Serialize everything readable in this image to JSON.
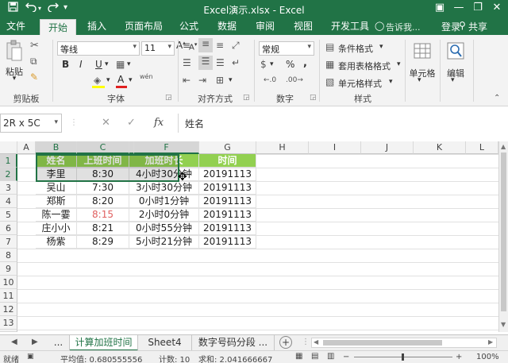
{
  "titlebar": {
    "title": "Excel演示.xlsx - Excel",
    "save_icon": "save-icon",
    "undo_icon": "undo-icon",
    "redo_icon": "redo-icon",
    "qa_more_icon": "customize-quick-access-icon",
    "ribbon_display": "▣",
    "minimize": "—",
    "restore": "❐",
    "close": "✕"
  },
  "tabs": {
    "items": [
      "文件",
      "开始",
      "插入",
      "页面布局",
      "公式",
      "数据",
      "审阅",
      "视图",
      "开发工具"
    ],
    "active": "开始",
    "tellme": "告诉我...",
    "login": "登录",
    "share": "共享"
  },
  "ribbon": {
    "clipboard": {
      "paste": "粘贴",
      "label": "剪贴板"
    },
    "font": {
      "name": "等线",
      "size": "11",
      "bold": "B",
      "italic": "I",
      "underline": "U",
      "grow": "A",
      "shrink": "A",
      "label": "字体",
      "wen": "wén"
    },
    "alignment": {
      "label": "对齐方式"
    },
    "number": {
      "format": "常规",
      "percent": "%",
      "comma": ",",
      "label": "数字"
    },
    "styles": {
      "conditional": "条件格式",
      "table": "套用表格格式",
      "cell": "单元格样式",
      "label": "样式"
    },
    "cells": {
      "label": "单元格"
    },
    "editing": {
      "label": "编辑"
    }
  },
  "formulabar": {
    "namebox": "2R x 5C",
    "cancel": "✕",
    "enter": "✓",
    "fx": "fx",
    "content": "姓名"
  },
  "grid": {
    "columns": [
      "A",
      "B",
      "C",
      "E",
      "F",
      "G",
      "H",
      "I",
      "J",
      "K",
      "L"
    ],
    "rows": [
      "1",
      "2",
      "3",
      "4",
      "5",
      "6",
      "7",
      "8",
      "9",
      "10",
      "11",
      "12",
      "13",
      "14"
    ],
    "header": {
      "name": "姓名",
      "start": "上班时间",
      "overtime": "加班时长",
      "time": "时间"
    },
    "data": [
      {
        "name": "李里",
        "start": "8:30",
        "overtime": "4小时30分钟",
        "time": "20191113"
      },
      {
        "name": "吴山",
        "start": "7:30",
        "overtime": "3小时30分钟",
        "time": "20191113"
      },
      {
        "name": "郑斯",
        "start": "8:20",
        "overtime": "0小时1分钟",
        "time": "20191113"
      },
      {
        "name": "陈一霎",
        "start": "8:15",
        "overtime": "2小时0分钟",
        "time": "20191113",
        "red": true
      },
      {
        "name": "庄小小",
        "start": "8:21",
        "overtime": "0小时55分钟",
        "time": "20191113"
      },
      {
        "name": "杨紫",
        "start": "8:29",
        "overtime": "5小时21分钟",
        "time": "20191113"
      }
    ],
    "header_color": "#92d050"
  },
  "sheets": {
    "ellipsis": "...",
    "items": [
      "计算加班时间",
      "Sheet4",
      "数字号码分段 ..."
    ],
    "active": "计算加班时间",
    "add": "+"
  },
  "status": {
    "ready": "就绪",
    "average": "平均值: 0.680555556",
    "count": "计数: 10",
    "sum": "求和: 2.041666667",
    "zoom": "100%"
  },
  "accent": "#217346"
}
